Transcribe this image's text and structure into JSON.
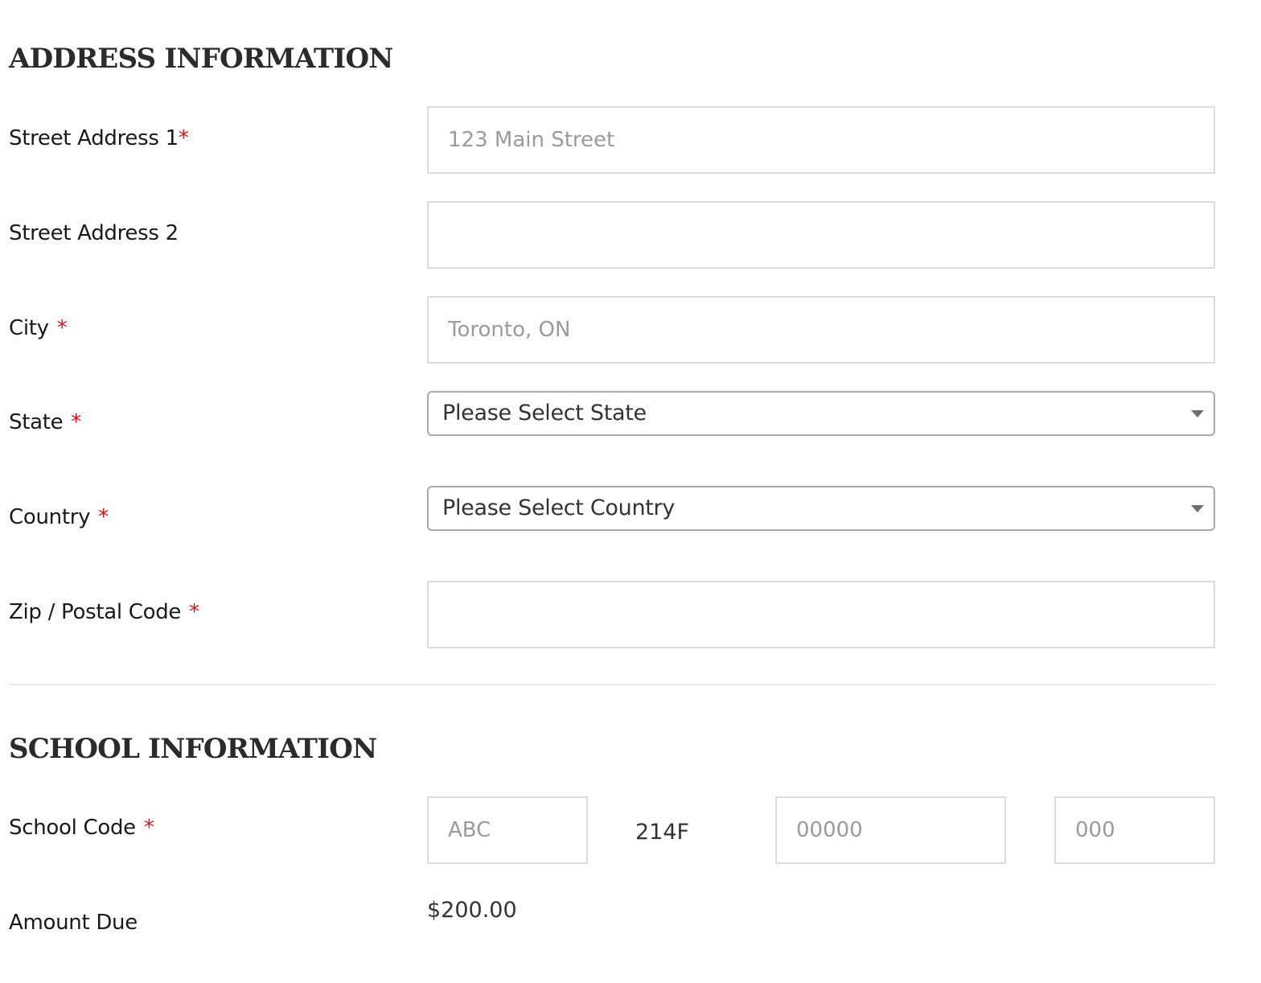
{
  "address": {
    "title": "ADDRESS INFORMATION",
    "street1": {
      "label": "Street Address 1",
      "required": "*",
      "placeholder": "123 Main Street"
    },
    "street2": {
      "label": "Street Address 2",
      "placeholder": ""
    },
    "city": {
      "label": "City",
      "required": "*",
      "placeholder": "Toronto, ON"
    },
    "state": {
      "label": "State",
      "required": "*",
      "selected": "Please Select State"
    },
    "country": {
      "label": "Country",
      "required": "*",
      "selected": "Please Select Country"
    },
    "zip": {
      "label": "Zip / Postal Code",
      "required": "*",
      "placeholder": ""
    }
  },
  "school": {
    "title": "SCHOOL INFORMATION",
    "code": {
      "label": "School Code",
      "required": "*",
      "part1_placeholder": "ABC",
      "fixed_segment": "214F",
      "part2_placeholder": "00000",
      "part3_placeholder": "000"
    },
    "amount": {
      "label": "Amount Due",
      "value": "$200.00"
    }
  },
  "colors": {
    "required_marker": "#e0101b",
    "input_border": "#dcdcdc",
    "select_border": "#a9a9a9",
    "placeholder_text": "#9b9b9b"
  }
}
